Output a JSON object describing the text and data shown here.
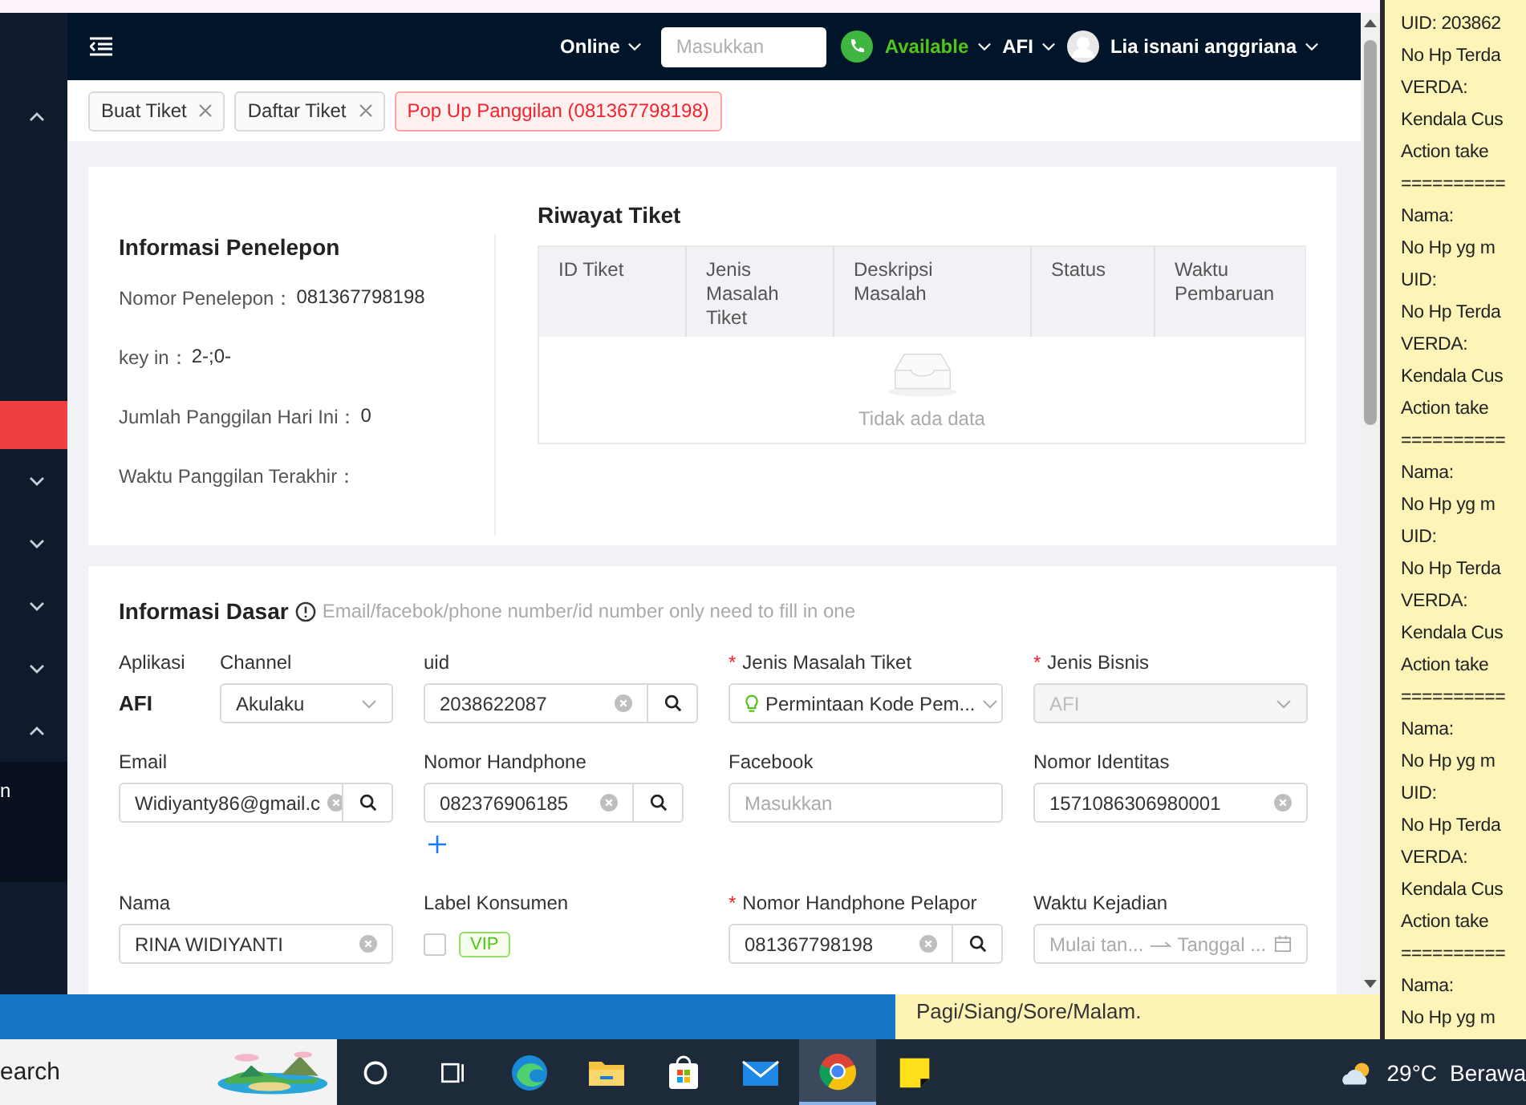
{
  "sidebar": {
    "items": [
      {
        "kind": "group",
        "expanded": true,
        "selected": false
      },
      {
        "kind": "link",
        "selected": true
      },
      {
        "kind": "group",
        "expanded": false,
        "selected": false
      },
      {
        "kind": "group",
        "expanded": false,
        "selected": false
      },
      {
        "kind": "group",
        "expanded": false,
        "selected": false
      },
      {
        "kind": "group",
        "expanded": false,
        "selected": false
      },
      {
        "kind": "group",
        "expanded": true,
        "selected": false
      },
      {
        "kind": "sub",
        "label": "n",
        "selected": false
      }
    ]
  },
  "header": {
    "status": "Online",
    "search": {
      "placeholder": "Masukkan"
    },
    "availability": "Available",
    "app": "AFI",
    "user": "Lia isnani anggriana"
  },
  "tabs": [
    {
      "label": "Buat Tiket",
      "selected": false,
      "closable": true
    },
    {
      "label": "Daftar Tiket",
      "selected": false,
      "closable": true
    },
    {
      "label": "Pop Up Panggilan (081367798198)",
      "selected": true,
      "closable": false
    }
  ],
  "caller_info": {
    "title": "Informasi Penelepon",
    "fields": [
      {
        "label": "Nomor Penelepon：",
        "value": "081367798198"
      },
      {
        "label": "key in：",
        "value": "2-;0-"
      },
      {
        "label": "Jumlah Panggilan Hari Ini：",
        "value": "0"
      },
      {
        "label": "Waktu Panggilan Terakhir："
      }
    ]
  },
  "ticket_history": {
    "title": "Riwayat Tiket",
    "columns": [
      "ID Tiket",
      "Jenis Masalah Tiket",
      "Deskripsi Masalah",
      "Status",
      "Waktu Pembaruan"
    ],
    "empty_text": "Tidak ada data"
  },
  "basic_info": {
    "title": "Informasi Dasar",
    "hint": "Email/facebok/phone number/id number only need to fill in one",
    "rows": [
      [
        [
          {
            "kind": "text",
            "label": "Aplikasi",
            "value": "AFI"
          },
          {
            "kind": "select",
            "label": "Channel",
            "value": "Akulaku"
          }
        ],
        [
          {
            "kind": "search",
            "label": "uid",
            "value": "2038622087",
            "clearable": true
          }
        ],
        [
          {
            "kind": "select",
            "label": "Jenis Masalah Tiket",
            "required_mark": "*",
            "value": "Permintaan Kode Pem...",
            "marked": true
          }
        ],
        [
          {
            "kind": "select",
            "label": "Jenis Bisnis",
            "required_mark": "*",
            "placeholder": "AFI",
            "disabled": true
          }
        ]
      ],
      [
        [
          {
            "kind": "search",
            "label": "Email",
            "value": "Widiyanty86@gmail.c",
            "clearable": true
          }
        ],
        [
          {
            "kind": "search",
            "label": "Nomor Handphone",
            "value": "082376906185",
            "clearable": true,
            "addable": true
          }
        ],
        [
          {
            "kind": "input",
            "label": "Facebook",
            "placeholder": "Masukkan"
          }
        ],
        [
          {
            "kind": "input",
            "label": "Nomor Identitas",
            "value": "1571086306980001",
            "clearable": true
          }
        ]
      ],
      [
        [
          {
            "kind": "input",
            "label": "Nama",
            "value": "RINA WIDIYANTI",
            "clearable": true
          }
        ],
        [
          {
            "kind": "tag",
            "label": "Label Konsumen",
            "checked": false,
            "tag": "VIP"
          }
        ],
        [
          {
            "kind": "search",
            "label": "Nomor Handphone Pelapor",
            "required_mark": "*",
            "value": "081367798198",
            "clearable": true
          }
        ],
        [
          {
            "kind": "date",
            "label": "Waktu Kejadian",
            "start_placeholder": "Mulai tan...",
            "end_placeholder": "Tanggal ..."
          }
        ]
      ]
    ]
  },
  "background_note": {
    "text": "Pagi/Siang/Sore/Malam."
  },
  "sticky_note": {
    "lines": [
      "UID: 203862",
      "No Hp Terda",
      "VERDA:",
      "Kendala Cus",
      "Action take",
      "==========",
      "Nama:",
      "No Hp yg m",
      "UID:",
      "No Hp Terda",
      "VERDA:",
      "Kendala Cus",
      "Action take",
      "==========",
      "Nama:",
      "No Hp yg m",
      "UID:",
      "No Hp Terda",
      "VERDA:",
      "Kendala Cus",
      "Action take",
      "==========",
      "Nama:",
      "No Hp yg m",
      "UID:",
      "No Hp Terda",
      "VERDA:",
      "Kendala Cus",
      "Action take",
      "==========",
      "Nama:",
      "No Hp yg m"
    ]
  },
  "taskbar": {
    "search": "earch",
    "apps": [
      {
        "kind": "cortana",
        "selected": false
      },
      {
        "kind": "taskview",
        "selected": false
      },
      {
        "kind": "edge",
        "selected": false
      },
      {
        "kind": "folder",
        "selected": false
      },
      {
        "kind": "store",
        "selected": false
      },
      {
        "kind": "mail",
        "selected": false
      },
      {
        "kind": "chrome",
        "selected": true
      },
      {
        "kind": "notes",
        "selected": false
      }
    ],
    "temperature": "29°C",
    "weather": "Berawa"
  }
}
